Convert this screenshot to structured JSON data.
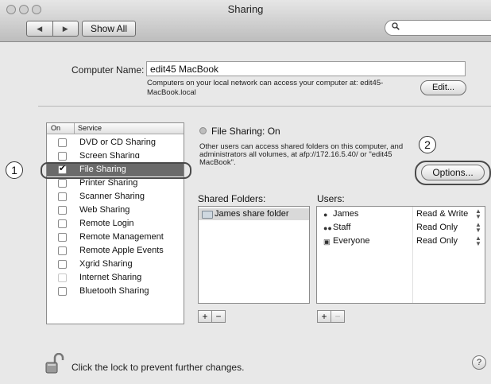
{
  "window": {
    "title": "Sharing"
  },
  "toolbar": {
    "back_glyph": "◀",
    "forward_glyph": "▶",
    "show_all_label": "Show All",
    "search_value": "",
    "search_icon": "magnifier-icon"
  },
  "computer": {
    "label": "Computer Name:",
    "value": "edit45 MacBook",
    "description": "Computers on your local network can access your computer at: edit45-MacBook.local",
    "edit_label": "Edit..."
  },
  "services": {
    "header_on": "On",
    "header_service": "Service",
    "items": [
      {
        "name": "DVD or CD Sharing",
        "checked": false,
        "selected": false
      },
      {
        "name": "Screen Sharing",
        "checked": false,
        "selected": false
      },
      {
        "name": "File Sharing",
        "checked": true,
        "selected": true
      },
      {
        "name": "Printer Sharing",
        "checked": false,
        "selected": false
      },
      {
        "name": "Scanner Sharing",
        "checked": false,
        "selected": false
      },
      {
        "name": "Web Sharing",
        "checked": false,
        "selected": false
      },
      {
        "name": "Remote Login",
        "checked": false,
        "selected": false
      },
      {
        "name": "Remote Management",
        "checked": false,
        "selected": false
      },
      {
        "name": "Remote Apple Events",
        "checked": false,
        "selected": false
      },
      {
        "name": "Xgrid Sharing",
        "checked": false,
        "selected": false
      },
      {
        "name": "Internet Sharing",
        "checked": false,
        "selected": false
      },
      {
        "name": "Bluetooth Sharing",
        "checked": false,
        "selected": false
      }
    ]
  },
  "detail": {
    "status": "File Sharing: On",
    "description": "Other users can access shared folders on this computer, and administrators all volumes, at afp://172.16.5.40/ or \"edit45 MacBook\".",
    "options_label": "Options...",
    "shared_folders_label": "Shared Folders:",
    "users_label": "Users:",
    "folders": [
      "James share folder"
    ],
    "users": [
      {
        "name": "James",
        "permission": "Read & Write",
        "icon": "single-user-icon"
      },
      {
        "name": "Staff",
        "permission": "Read Only",
        "icon": "group-icon"
      },
      {
        "name": "Everyone",
        "permission": "Read Only",
        "icon": "everyone-icon"
      }
    ],
    "add_glyph": "+",
    "remove_glyph": "−"
  },
  "callouts": {
    "one": "1",
    "two": "2"
  },
  "footer": {
    "lock_text": "Click the lock to prevent further changes.",
    "help_glyph": "?"
  }
}
